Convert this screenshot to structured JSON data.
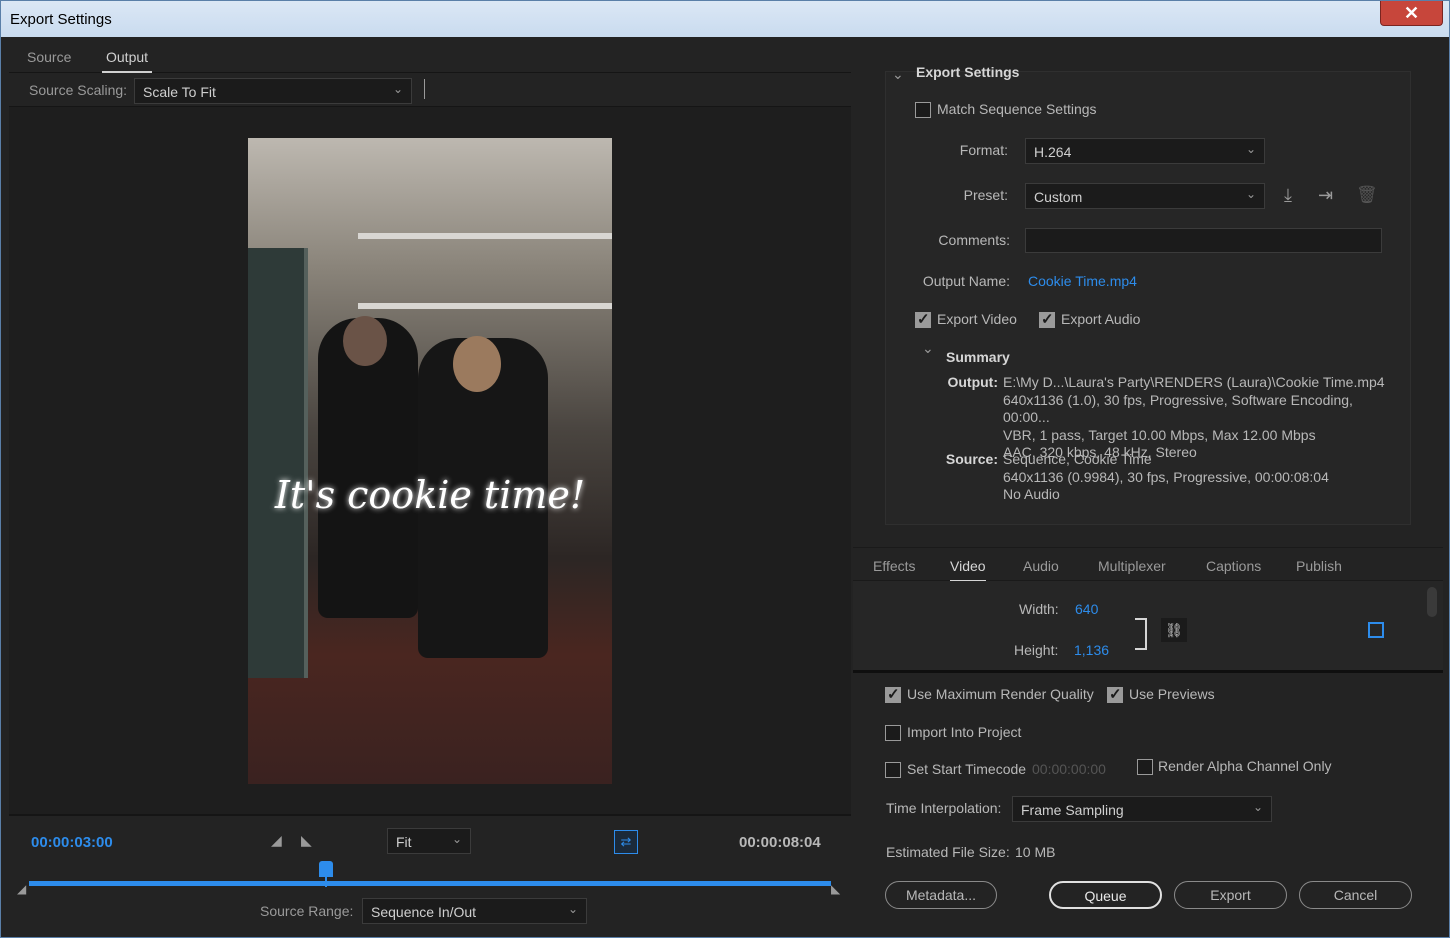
{
  "window": {
    "title": "Export Settings",
    "close_glyph": "✕"
  },
  "left": {
    "tabs": [
      {
        "label": "Source"
      },
      {
        "label": "Output"
      }
    ],
    "source_scaling": {
      "label": "Source Scaling:",
      "value": "Scale To Fit"
    },
    "preview": {
      "caption": "It's cookie time!"
    },
    "timeline": {
      "current_timecode": "00:00:03:00",
      "end_timecode": "00:00:08:04",
      "zoom": "Fit",
      "source_range_label": "Source Range:",
      "source_range_value": "Sequence In/Out",
      "playhead_position": 0.37
    }
  },
  "export_settings": {
    "header": "Export Settings",
    "match_sequence": "Match Sequence Settings",
    "format_label": "Format:",
    "format_value": "H.264",
    "preset_label": "Preset:",
    "preset_value": "Custom",
    "comments_label": "Comments:",
    "comments_value": "",
    "output_name_label": "Output Name:",
    "output_name_value": "Cookie Time.mp4",
    "export_video": "Export Video",
    "export_audio": "Export Audio",
    "summary": {
      "header": "Summary",
      "output_key": "Output:",
      "output_lines": [
        "E:\\My D...\\Laura's Party\\RENDERS (Laura)\\Cookie Time.mp4",
        "640x1136 (1.0), 30 fps, Progressive, Software Encoding, 00:00...",
        "VBR, 1 pass, Target 10.00 Mbps, Max 12.00 Mbps",
        "AAC, 320 kbps, 48 kHz, Stereo"
      ],
      "source_key": "Source:",
      "source_lines": [
        "Sequence, Cookie Time",
        "640x1136 (0.9984), 30 fps, Progressive, 00:00:08:04",
        "No Audio"
      ]
    }
  },
  "video_tabs": [
    {
      "label": "Effects"
    },
    {
      "label": "Video"
    },
    {
      "label": "Audio"
    },
    {
      "label": "Multiplexer"
    },
    {
      "label": "Captions"
    },
    {
      "label": "Publish"
    }
  ],
  "video": {
    "width_label": "Width:",
    "width_value": "640",
    "height_label": "Height:",
    "height_value": "1,136"
  },
  "bottom": {
    "max_render": "Use Maximum Render Quality",
    "use_previews": "Use Previews",
    "import_project": "Import Into Project",
    "set_start_tc": "Set Start Timecode",
    "start_tc_value": "00:00:00:00",
    "render_alpha": "Render Alpha Channel Only",
    "time_interp_label": "Time Interpolation:",
    "time_interp_value": "Frame Sampling",
    "est_size_label": "Estimated File Size:",
    "est_size_value": "10 MB",
    "buttons": {
      "metadata": "Metadata...",
      "queue": "Queue",
      "export": "Export",
      "cancel": "Cancel"
    }
  },
  "colors": {
    "accent": "#2d8ceb",
    "panel": "#232323"
  }
}
